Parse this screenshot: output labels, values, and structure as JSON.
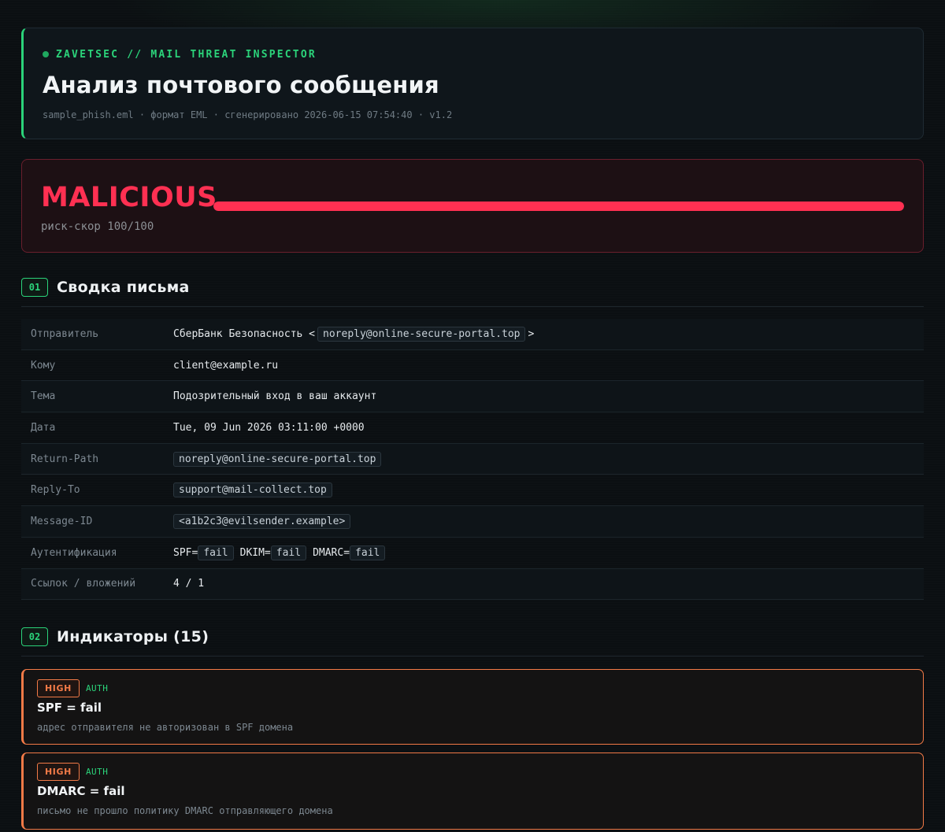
{
  "header": {
    "brand": "ZAVETSEC // MAIL THREAT INSPECTOR",
    "title": "Анализ почтового сообщения",
    "meta": "sample_phish.eml · формат EML · сгенерировано 2026-06-15 07:54:40 · v1.2"
  },
  "verdict": {
    "label": "MALICIOUS",
    "risk_text": "риск-скор 100/100",
    "risk_score": 100,
    "risk_max": 100,
    "color": "#ff3052"
  },
  "summary": {
    "number": "01",
    "title": "Сводка письма",
    "rows": {
      "sender": {
        "key": "Отправитель",
        "name": "СберБанк Безопасность <",
        "email": "noreply@online-secure-portal.top",
        "close": ">"
      },
      "to": {
        "key": "Кому",
        "value": "client@example.ru"
      },
      "subject": {
        "key": "Тема",
        "value": "Подозрительный вход в ваш аккаунт"
      },
      "date": {
        "key": "Дата",
        "value": "Tue, 09 Jun 2026 03:11:00 +0000"
      },
      "return_path": {
        "key": "Return-Path",
        "value": "noreply@online-secure-portal.top"
      },
      "reply_to": {
        "key": "Reply-To",
        "value": "support@mail-collect.top"
      },
      "message_id": {
        "key": "Message-ID",
        "value": "<a1b2c3@evilsender.example>"
      },
      "auth": {
        "key": "Аутентификация",
        "spf_label": "SPF=",
        "spf": "fail",
        "dkim_label": "DKIM=",
        "dkim": "fail",
        "dmarc_label": "DMARC=",
        "dmarc": "fail"
      },
      "links": {
        "key": "Ссылок / вложений",
        "value": "4 / 1"
      }
    }
  },
  "indicators": {
    "number": "02",
    "title": "Индикаторы (15)",
    "items": [
      {
        "severity": "HIGH",
        "category": "AUTH",
        "title": "SPF = fail",
        "description": "адрес отправителя не авторизован в SPF домена"
      },
      {
        "severity": "HIGH",
        "category": "AUTH",
        "title": "DMARC = fail",
        "description": "письмо не прошло политику DMARC отправляющего домена"
      }
    ]
  },
  "colors": {
    "accent": "#2bd37a",
    "malicious": "#ff3052",
    "high": "#f27a47"
  }
}
